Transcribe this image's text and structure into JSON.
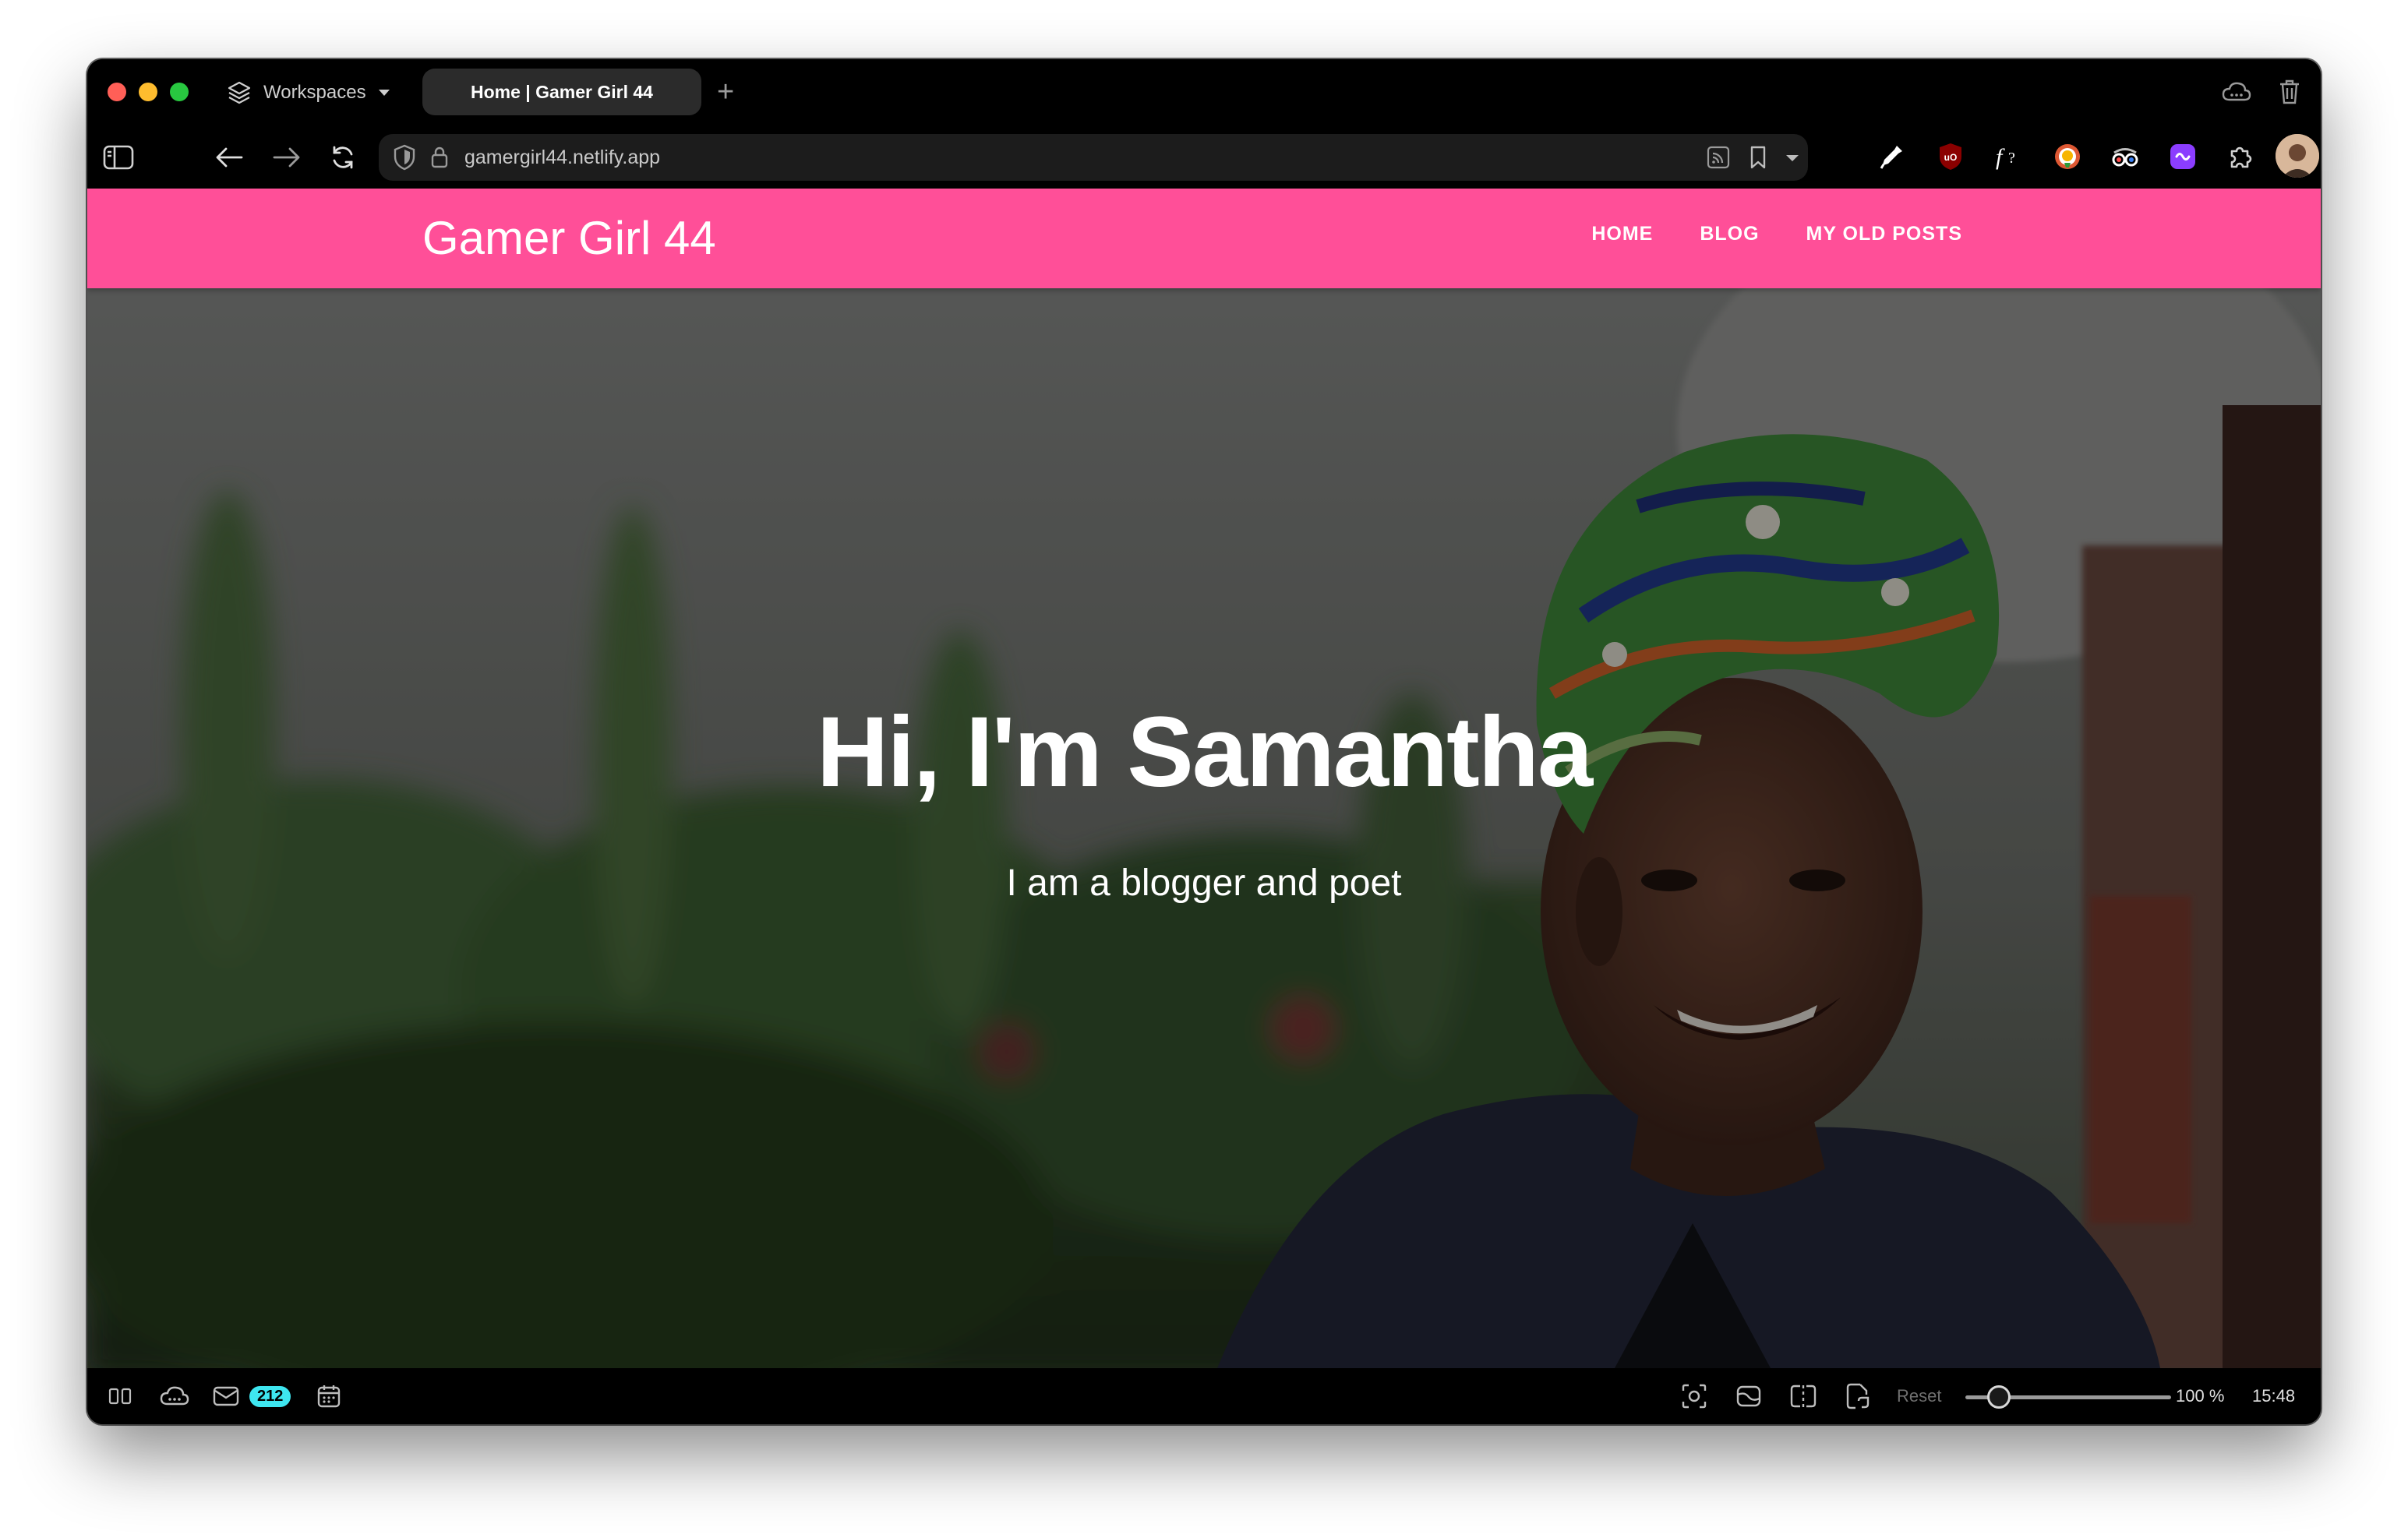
{
  "browser": {
    "workspaces_label": "Workspaces",
    "active_tab_title": "Home | Gamer Girl 44",
    "new_tab_symbol": "+",
    "url": "gamergirl44.netlify.app"
  },
  "site": {
    "title": "Gamer Girl 44",
    "nav": [
      "HOME",
      "BLOG",
      "MY OLD POSTS"
    ],
    "accent_color": "#ff4f98"
  },
  "hero": {
    "heading": "Hi, I'm Samantha",
    "subheading": "I am a blogger and poet"
  },
  "statusbar": {
    "mail_count": "212",
    "reset_label": "Reset",
    "zoom_level": "100 %",
    "zoom_value": 100,
    "clock": "15:48"
  },
  "icons": {
    "tabbar": [
      "workspaces-icon",
      "cloud-icon",
      "trash-icon"
    ],
    "navbar": [
      "sidebar-toggle-icon",
      "back-arrow-icon",
      "forward-arrow-icon",
      "reload-icon",
      "shield-icon",
      "lock-icon",
      "rss-icon",
      "bookmark-icon",
      "chevron-down-icon"
    ],
    "extensions": [
      "color-picker-icon",
      "ublock-icon",
      "font-finder-icon",
      "duckduckgo-icon",
      "spy-glasses-icon",
      "extension-purple-icon",
      "puzzle-icon",
      "profile-avatar"
    ],
    "statusbar": [
      "panels-icon",
      "cloud-sync-icon",
      "mail-icon",
      "calendar-icon",
      "screenshot-icon",
      "capture-icon",
      "tiling-icon",
      "page-actions-icon"
    ]
  }
}
